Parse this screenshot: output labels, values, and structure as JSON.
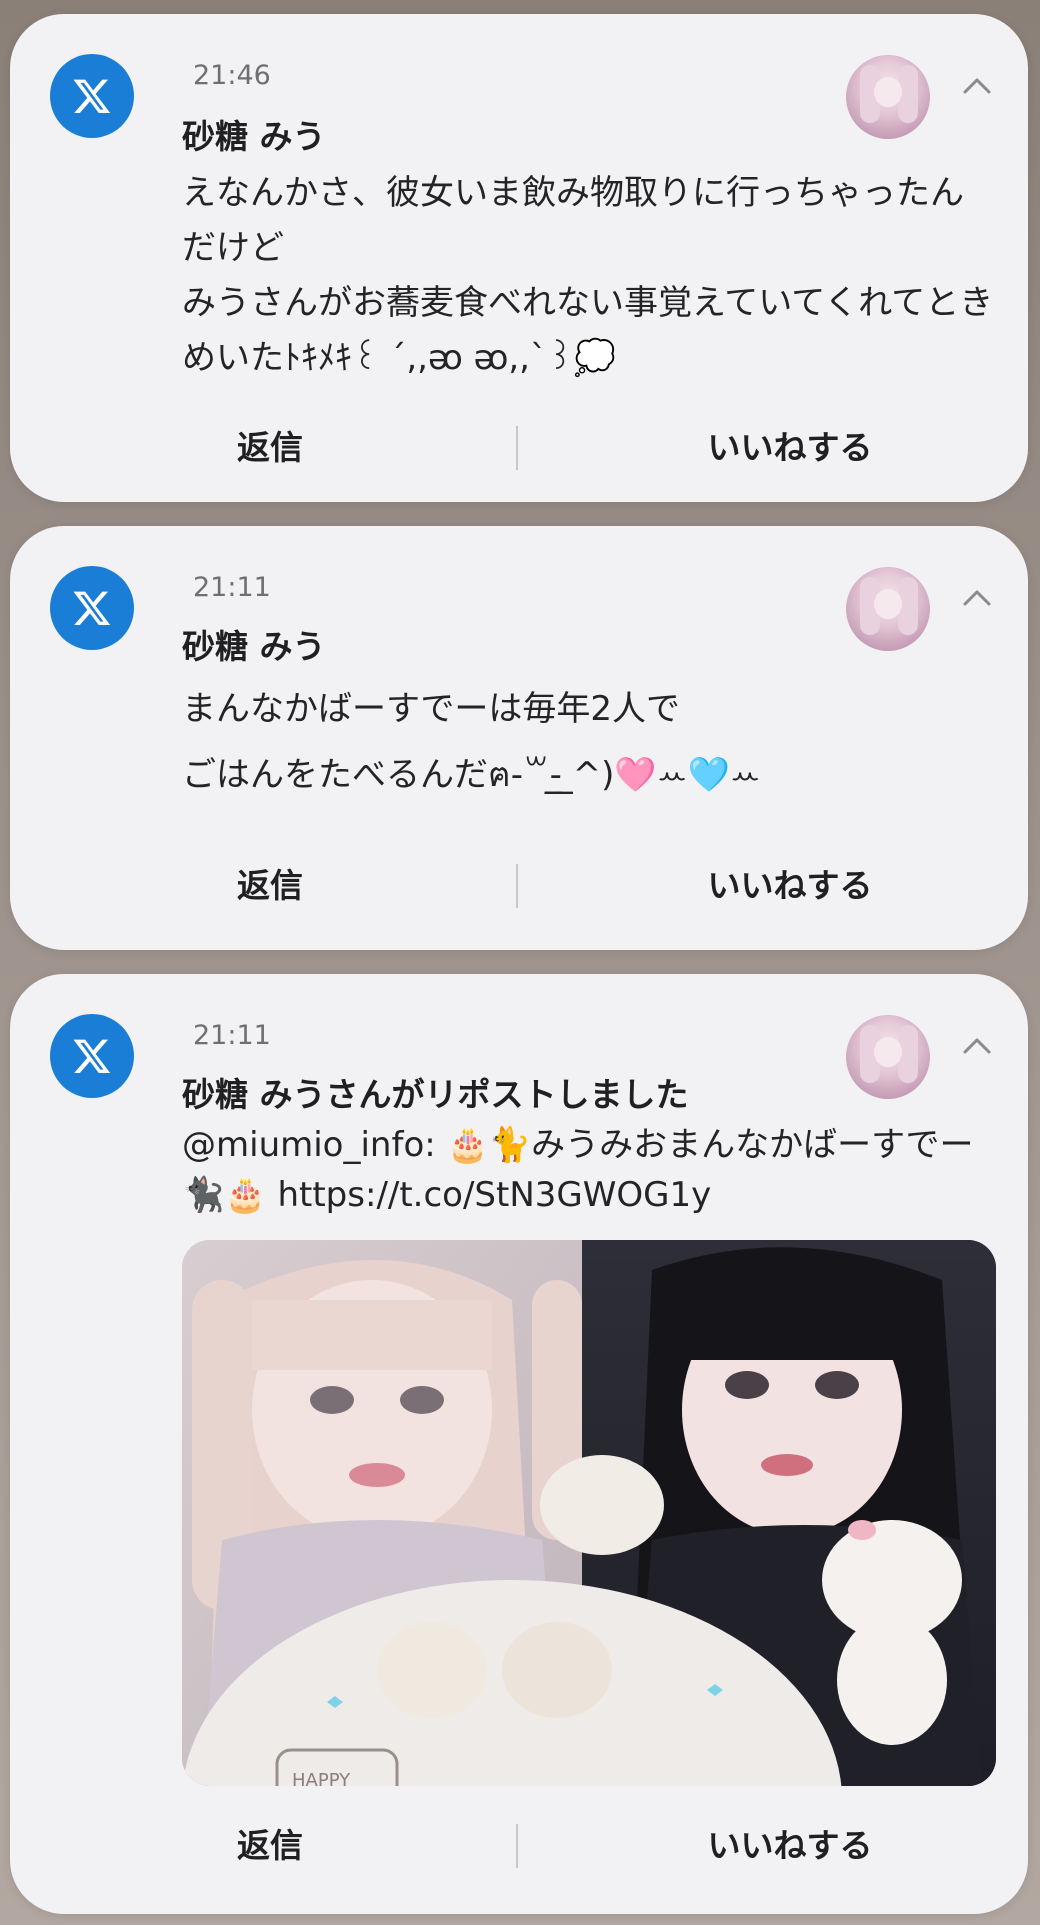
{
  "notifications": [
    {
      "time": "21:46",
      "sender": "砂糖 みう",
      "body": "えなんかさ、彼女いま飲み物取りに行っちゃったんだけど\nみうさんがお蕎麦食べれない事覚えていてくれてときめいたﾄｷﾒｷ꒰ ˊ,,ᴔ ᴔ,,ˋ꒱💭",
      "reply_label": "返信",
      "like_label": "いいねする"
    },
    {
      "time": "21:11",
      "sender": "砂糖 みう",
      "body": "まんなかばーすでーは毎年2人で\nごはんをたべるんだ‎ฅ-꒳-̲̲ ̲^)🩷ꕀ🩵ꕀ",
      "reply_label": "返信",
      "like_label": "いいねする"
    },
    {
      "time": "21:11",
      "sender": "砂糖 みうさんがリポストしました",
      "body": "@miumio_info: 🎂🐈みうみおまんなかばーすでー🐈‍⬛🎂 https://t.co/StN3GWOG1y",
      "reply_label": "返信",
      "like_label": "いいねする",
      "photo_text": "HAPPY"
    }
  ],
  "colors": {
    "x_icon_bg": "#1a7ed6",
    "card_bg": "#f2f2f4"
  },
  "icons": {
    "app": "x-logo-icon",
    "collapse": "chevron-up-icon",
    "avatar": "user-avatar"
  }
}
